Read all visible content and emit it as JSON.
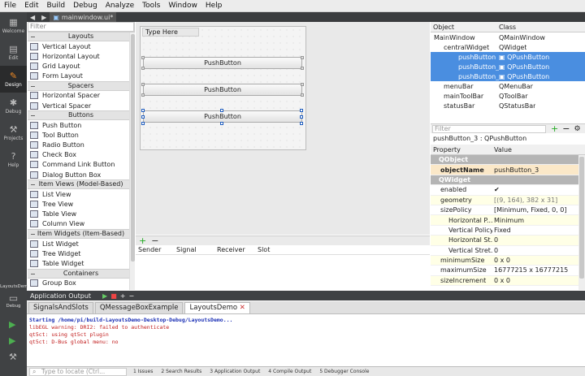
{
  "menubar": {
    "items": [
      "File",
      "Edit",
      "Build",
      "Debug",
      "Analyze",
      "Tools",
      "Window",
      "Help"
    ]
  },
  "modes": [
    {
      "label": "Welcome",
      "icon": "grid-icon"
    },
    {
      "label": "Edit",
      "icon": "document-icon"
    },
    {
      "label": "Design",
      "icon": "pencil-icon"
    },
    {
      "label": "Debug",
      "icon": "bug-icon"
    },
    {
      "label": "Projects",
      "icon": "wrench-icon"
    },
    {
      "label": "Help",
      "icon": "help-icon"
    }
  ],
  "kit": {
    "project": "LayoutsDemo",
    "target": "Debug"
  },
  "doc_tab": {
    "name": "mainwindow.ui*"
  },
  "widgetbox": {
    "filter_placeholder": "Filter",
    "categories": [
      {
        "name": "Layouts",
        "items": [
          "Vertical Layout",
          "Horizontal Layout",
          "Grid Layout",
          "Form Layout"
        ]
      },
      {
        "name": "Spacers",
        "items": [
          "Horizontal Spacer",
          "Vertical Spacer"
        ]
      },
      {
        "name": "Buttons",
        "items": [
          "Push Button",
          "Tool Button",
          "Radio Button",
          "Check Box",
          "Command Link Button",
          "Dialog Button Box"
        ]
      },
      {
        "name": "Item Views (Model-Based)",
        "items": [
          "List View",
          "Tree View",
          "Table View",
          "Column View"
        ]
      },
      {
        "name": "Item Widgets (Item-Based)",
        "items": [
          "List Widget",
          "Tree Widget",
          "Table Widget"
        ]
      },
      {
        "name": "Containers",
        "items": [
          "Group Box"
        ]
      }
    ]
  },
  "form": {
    "type_here": "Type Here",
    "buttons": [
      "PushButton",
      "PushButton",
      "PushButton"
    ]
  },
  "signals": {
    "columns": [
      "Sender",
      "Signal",
      "Receiver",
      "Slot"
    ]
  },
  "object_inspector": {
    "columns": [
      "Object",
      "Class"
    ],
    "rows": [
      {
        "object": "MainWindow",
        "class": "QMainWindow",
        "indent": 0,
        "selected": false
      },
      {
        "object": "centralWidget",
        "class": "QWidget",
        "indent": 1,
        "selected": false
      },
      {
        "object": "pushButton",
        "class": "QPushButton",
        "indent": 2,
        "selected": true
      },
      {
        "object": "pushButton_2",
        "class": "QPushButton",
        "indent": 2,
        "selected": true
      },
      {
        "object": "pushButton_3",
        "class": "QPushButton",
        "indent": 2,
        "selected": true
      },
      {
        "object": "menuBar",
        "class": "QMenuBar",
        "indent": 1,
        "selected": false
      },
      {
        "object": "mainToolBar",
        "class": "QToolBar",
        "indent": 1,
        "selected": false
      },
      {
        "object": "statusBar",
        "class": "QStatusBar",
        "indent": 1,
        "selected": false
      }
    ]
  },
  "property_editor": {
    "filter_placeholder": "Filter",
    "title": "pushButton_3 : QPushButton",
    "columns": [
      "Property",
      "Value"
    ],
    "rows": [
      {
        "name": "QObject",
        "value": "",
        "kind": "group"
      },
      {
        "name": "objectName",
        "value": "pushButton_3",
        "kind": "hl"
      },
      {
        "name": "QWidget",
        "value": "",
        "kind": "group"
      },
      {
        "name": "enabled",
        "value": "✔",
        "kind": "plain"
      },
      {
        "name": "geometry",
        "value": "[(9, 164), 382 x 31]",
        "kind": "alt"
      },
      {
        "name": "sizePolicy",
        "value": "[Minimum, Fixed, 0, 0]",
        "kind": "plain"
      },
      {
        "name": "Horizontal P...",
        "value": "Minimum",
        "kind": "sub-alt"
      },
      {
        "name": "Vertical Policy",
        "value": "Fixed",
        "kind": "sub"
      },
      {
        "name": "Horizontal St...",
        "value": "0",
        "kind": "sub-alt"
      },
      {
        "name": "Vertical Stret...",
        "value": "0",
        "kind": "sub"
      },
      {
        "name": "minimumSize",
        "value": "0 x 0",
        "kind": "alt"
      },
      {
        "name": "maximumSize",
        "value": "16777215 x 16777215",
        "kind": "plain"
      },
      {
        "name": "sizeIncrement",
        "value": "0 x 0",
        "kind": "alt"
      }
    ]
  },
  "output": {
    "title": "Application Output",
    "tabs": [
      "SignalsAndSlots",
      "QMessageBoxExample",
      "LayoutsDemo"
    ],
    "active_tab": 2,
    "lines": [
      {
        "text": "Starting /home/pi/build-LayoutsDemo-Desktop-Debug/LayoutsDemo...",
        "color": "#1a2fb5",
        "bold": true
      },
      {
        "text": "libEGL warning: DRI2: failed to authenticate",
        "color": "#c01818",
        "bold": false
      },
      {
        "text": "qt5ct: using qt5ct plugin",
        "color": "#c01818",
        "bold": false
      },
      {
        "text": "qt5ct: D-Bus global menu: no",
        "color": "#c01818",
        "bold": false
      }
    ]
  },
  "statusbar": {
    "locator_placeholder": "Type to locate (Ctrl...",
    "panes": [
      "1 Issues",
      "2 Search Results",
      "3 Application Output",
      "4 Compile Output",
      "5 Debugger Console"
    ]
  }
}
